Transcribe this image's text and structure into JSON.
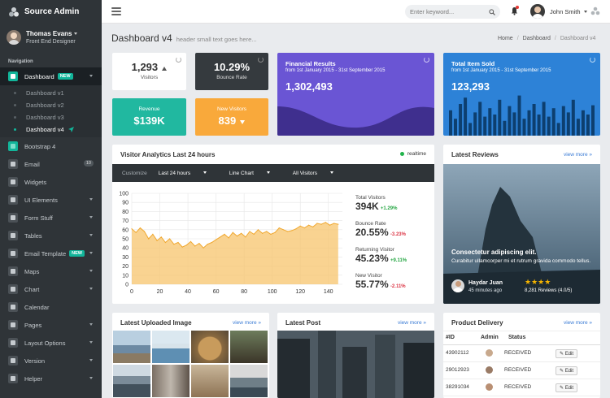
{
  "app": {
    "name": "Source Admin"
  },
  "topbar": {
    "search_placeholder": "Enter keyword...",
    "user_name": "John Smith"
  },
  "sidebar": {
    "profile_name": "Thomas Evans",
    "profile_role": "Front End Designer",
    "nav_title": "Navigation",
    "items": [
      {
        "label": "Dashboard",
        "badge": "NEW"
      },
      {
        "label": "Bootstrap 4"
      },
      {
        "label": "Email",
        "count": "10"
      },
      {
        "label": "Widgets"
      },
      {
        "label": "UI Elements"
      },
      {
        "label": "Form Stuff"
      },
      {
        "label": "Tables"
      },
      {
        "label": "Email Template",
        "badge": "NEW"
      },
      {
        "label": "Maps"
      },
      {
        "label": "Chart"
      },
      {
        "label": "Calendar"
      },
      {
        "label": "Pages"
      },
      {
        "label": "Layout Options"
      },
      {
        "label": "Version"
      },
      {
        "label": "Helper"
      }
    ],
    "subitems": [
      "Dashboard v1",
      "Dashboard v2",
      "Dashboard v3",
      "Dashboard v4"
    ]
  },
  "page": {
    "title": "Dashboard v4",
    "subtitle": "header small text goes here...",
    "breadcrumb": [
      "Home",
      "Dashboard",
      "Dashboard v4"
    ]
  },
  "kpis": {
    "visitors_value": "1,293",
    "visitors_label": "Visitors",
    "bounce_value": "10.29%",
    "bounce_label": "Bounce Rate",
    "revenue_label": "Revenue",
    "revenue_value": "$139K",
    "newvis_label": "New Visitors",
    "newvis_value": "839"
  },
  "financial": {
    "title": "Financial Results",
    "period": "from 1st January 2015 - 31st September 2015",
    "value": "1,302,493"
  },
  "itemsold": {
    "title": "Total Item Sold",
    "period": "from 1st January 2015 - 31st September 2015",
    "value": "123,293",
    "bars": [
      0.6,
      0.4,
      0.75,
      0.9,
      0.3,
      0.55,
      0.8,
      0.45,
      0.65,
      0.5,
      0.85,
      0.35,
      0.7,
      0.55,
      0.95,
      0.4,
      0.6,
      0.75,
      0.5,
      0.8,
      0.45,
      0.65,
      0.3,
      0.7,
      0.55,
      0.85,
      0.4,
      0.6,
      0.5,
      0.72
    ]
  },
  "analytics": {
    "title": "Visitor Analytics Last 24 hours",
    "status": "realtime",
    "toolbar": [
      "Customize",
      "Last 24 hours",
      "Line Chart",
      "All Visitors"
    ],
    "stats": [
      {
        "label": "Total Visitors",
        "value": "394K",
        "delta": "+1.29%",
        "dir": "up"
      },
      {
        "label": "Bounce Rate",
        "value": "20.55%",
        "delta": "-3.23%",
        "dir": "down"
      },
      {
        "label": "Returning Visitor",
        "value": "45.23%",
        "delta": "+9.11%",
        "dir": "up"
      },
      {
        "label": "New Visitor",
        "value": "55.77%",
        "delta": "-2.11%",
        "dir": "down"
      }
    ]
  },
  "chart_data": {
    "type": "area",
    "title": "",
    "xlabel": "",
    "ylabel": "",
    "xlim": [
      0,
      150
    ],
    "ylim": [
      0,
      100
    ],
    "xticks": [
      "0",
      "20",
      "40",
      "60",
      "80",
      "100",
      "120",
      "140"
    ],
    "yticks": [
      "0",
      "10",
      "20",
      "30",
      "40",
      "50",
      "60",
      "70",
      "80",
      "90",
      "100"
    ],
    "color": "#f7c46c",
    "x": [
      0,
      3,
      6,
      9,
      12,
      15,
      18,
      21,
      24,
      27,
      30,
      33,
      36,
      39,
      42,
      45,
      48,
      51,
      54,
      57,
      60,
      63,
      66,
      69,
      72,
      75,
      78,
      81,
      84,
      87,
      90,
      93,
      96,
      99,
      102,
      105,
      108,
      111,
      114,
      117,
      120,
      123,
      126,
      129,
      132,
      135,
      138,
      141,
      144,
      147
    ],
    "values": [
      61,
      57,
      62,
      58,
      50,
      55,
      48,
      52,
      46,
      50,
      44,
      46,
      41,
      43,
      47,
      42,
      45,
      40,
      44,
      46,
      49,
      52,
      55,
      51,
      57,
      53,
      56,
      52,
      58,
      55,
      60,
      56,
      58,
      55,
      57,
      62,
      60,
      58,
      59,
      61,
      64,
      62,
      65,
      63,
      67,
      66,
      68,
      65,
      67,
      66
    ]
  },
  "reviews": {
    "title": "Latest Reviews",
    "viewmore": "view more",
    "headline": "Consectetur adipiscing elit.",
    "text": "Curabitur ullamcorper mi et rutrum gravida commodo tellus.",
    "author": "Haydar Juan",
    "time": "45 minutes ago",
    "rating_text": "8,281 Reviews (4.0/5)",
    "stars": 4
  },
  "uploads": {
    "title": "Latest Uploaded Image",
    "viewmore": "view more"
  },
  "post": {
    "title": "Latest Post",
    "viewmore": "view more"
  },
  "delivery": {
    "title": "Product Delivery",
    "viewmore": "view more",
    "columns": [
      "#ID",
      "Admin",
      "Status"
    ],
    "rows": [
      {
        "id": "43902112",
        "status": "RECEIVED",
        "action": "Edit"
      },
      {
        "id": "29012923",
        "status": "RECEIVED",
        "action": "Edit"
      },
      {
        "id": "38291034",
        "status": "RECEIVED",
        "action": "Edit"
      }
    ]
  }
}
